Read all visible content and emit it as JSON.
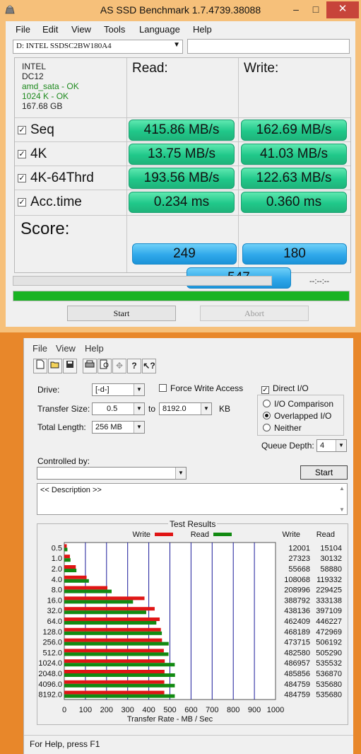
{
  "asssd": {
    "title": "AS SSD Benchmark 1.7.4739.38088",
    "window_buttons": {
      "minimize": "–",
      "maximize": "□",
      "close": "✕"
    },
    "menu": [
      "File",
      "Edit",
      "View",
      "Tools",
      "Language",
      "Help"
    ],
    "drive_select": "D: INTEL SSDSC2BW180A4",
    "info": {
      "vendor": "INTEL",
      "firmware": "DC12",
      "driver_status": "amd_sata - OK",
      "alignment_status": "1024 K - OK",
      "capacity": "167.68 GB"
    },
    "headers": {
      "read": "Read:",
      "write": "Write:"
    },
    "rows": [
      {
        "label": "Seq",
        "checked": true,
        "read": "415.86 MB/s",
        "write": "162.69 MB/s"
      },
      {
        "label": "4K",
        "checked": true,
        "read": "13.75 MB/s",
        "write": "41.03 MB/s"
      },
      {
        "label": "4K-64Thrd",
        "checked": true,
        "read": "193.56 MB/s",
        "write": "122.63 MB/s"
      },
      {
        "label": "Acc.time",
        "checked": true,
        "read": "0.234 ms",
        "write": "0.360 ms"
      }
    ],
    "score": {
      "label": "Score:",
      "read": "249",
      "write": "180",
      "total": "547"
    },
    "time_display": "--:--:--",
    "progress_fraction": 1.0,
    "buttons": {
      "start": "Start",
      "abort": "Abort"
    },
    "colors": {
      "result_green": "#20c88a",
      "score_blue": "#2fa8ea",
      "progress_green": "#1ab323",
      "close_red": "#c7443a"
    }
  },
  "atto": {
    "menu": [
      "File",
      "View",
      "Help"
    ],
    "toolbar_icons": [
      "new-icon",
      "open-icon",
      "save-icon",
      "print-icon",
      "print-preview-icon",
      "move-icon",
      "help-icon",
      "context-help-icon"
    ],
    "drive_label": "Drive:",
    "drive_value": "[-d-]",
    "force_write_label": "Force Write Access",
    "force_write_checked": false,
    "direct_io_label": "Direct I/O",
    "direct_io_checked": true,
    "transfer_size_label": "Transfer Size:",
    "transfer_from": "0.5",
    "to_label": "to",
    "transfer_to": "8192.0",
    "kb_label": "KB",
    "total_length_label": "Total Length:",
    "total_length": "256 MB",
    "io_options": [
      {
        "label": "I/O Comparison",
        "selected": false
      },
      {
        "label": "Overlapped I/O",
        "selected": true
      },
      {
        "label": "Neither",
        "selected": false
      }
    ],
    "queue_depth_label": "Queue Depth:",
    "queue_depth": "4",
    "controlled_by_label": "Controlled by:",
    "controlled_by_value": "",
    "start_label": "Start",
    "description": "<< Description >>",
    "status_text": "For Help, press F1"
  },
  "chart_data": {
    "type": "bar",
    "title": "Test Results",
    "xlabel": "Transfer Rate - MB / Sec",
    "ylabel": "",
    "xlim": [
      0,
      1000
    ],
    "x_ticks": [
      "0",
      "100",
      "200",
      "300",
      "400",
      "500",
      "600",
      "700",
      "800",
      "900",
      "1000"
    ],
    "orientation": "horizontal",
    "legend": [
      {
        "name": "Write",
        "color": "#e01515"
      },
      {
        "name": "Read",
        "color": "#128a12"
      }
    ],
    "legend_placement": "top",
    "table_headers": [
      "Write",
      "Read"
    ],
    "categories": [
      "0.5",
      "1.0",
      "2.0",
      "4.0",
      "8.0",
      "16.0",
      "32.0",
      "64.0",
      "128.0",
      "256.0",
      "512.0",
      "1024.0",
      "2048.0",
      "4096.0",
      "8192.0"
    ],
    "series": [
      {
        "name": "Write",
        "values": [
          12001,
          27323,
          55668,
          108068,
          208996,
          388792,
          438136,
          462409,
          468189,
          473715,
          482580,
          486957,
          485856,
          484759,
          484759
        ]
      },
      {
        "name": "Read",
        "values": [
          15104,
          30132,
          58880,
          119332,
          229425,
          333138,
          397109,
          446227,
          472969,
          506192,
          505290,
          535532,
          536870,
          535680,
          535680
        ]
      }
    ],
    "grid": true
  }
}
